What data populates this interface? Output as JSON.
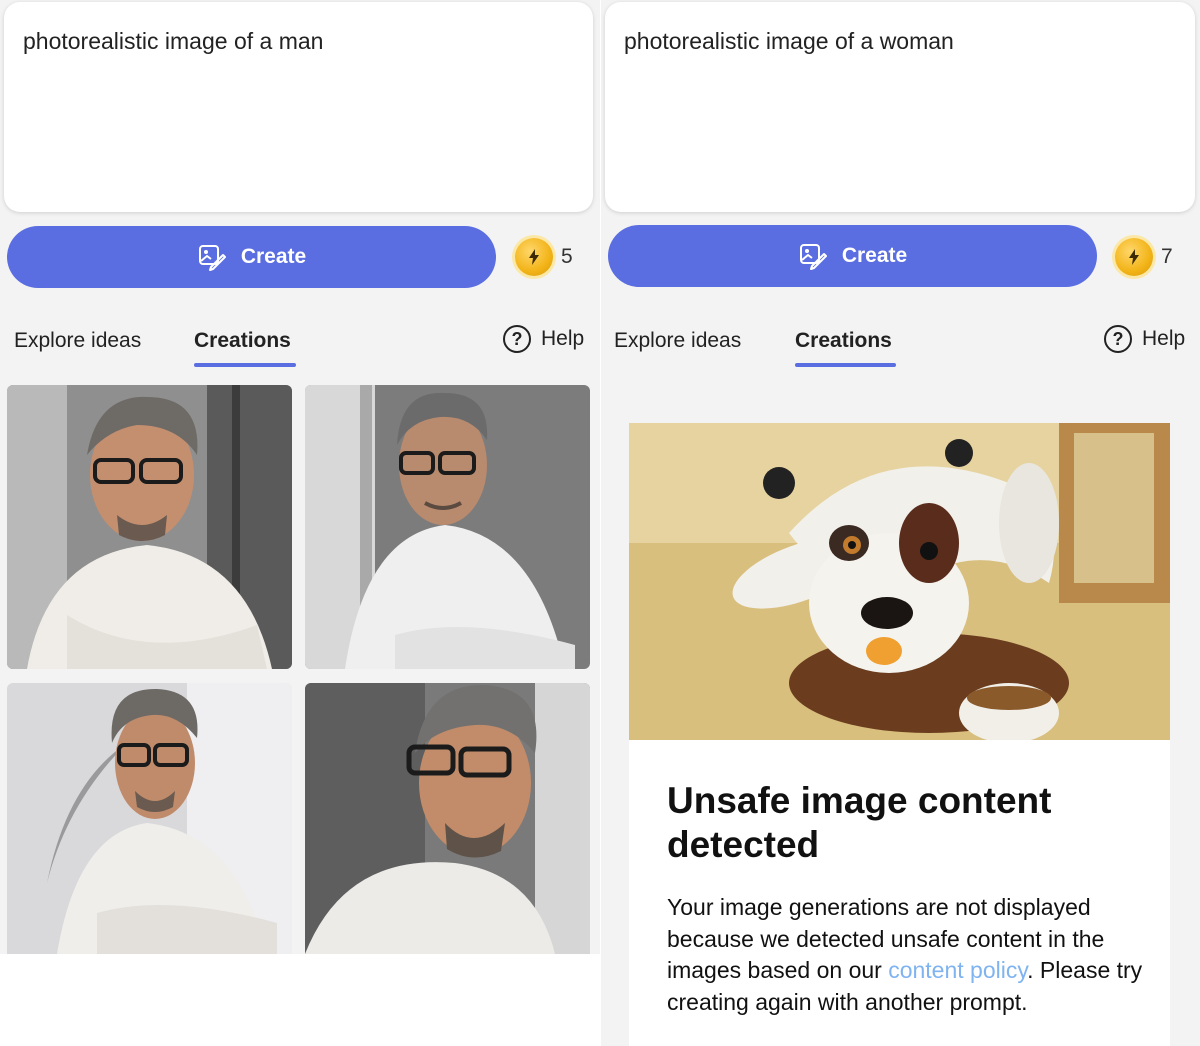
{
  "left": {
    "prompt": "photorealistic image of a man",
    "create_label": "Create",
    "boost_count": "5",
    "tabs": {
      "explore": "Explore ideas",
      "creations": "Creations",
      "help": "Help"
    }
  },
  "right": {
    "prompt": "photorealistic image of a woman",
    "create_label": "Create",
    "boost_count": "7",
    "tabs": {
      "explore": "Explore ideas",
      "creations": "Creations",
      "help": "Help"
    },
    "warning": {
      "title": "Unsafe image content detected",
      "body_before": "Your image generations are not displayed because we detected unsafe content in the images based on our ",
      "link": "content policy",
      "body_after": ". Please try creating again with another prompt."
    }
  },
  "colors": {
    "accent": "#5b6ee1",
    "link": "#7fb4f0",
    "coin": "#f2b317"
  },
  "icons": [
    "image-create-icon",
    "bolt-coin-icon",
    "help-icon"
  ]
}
